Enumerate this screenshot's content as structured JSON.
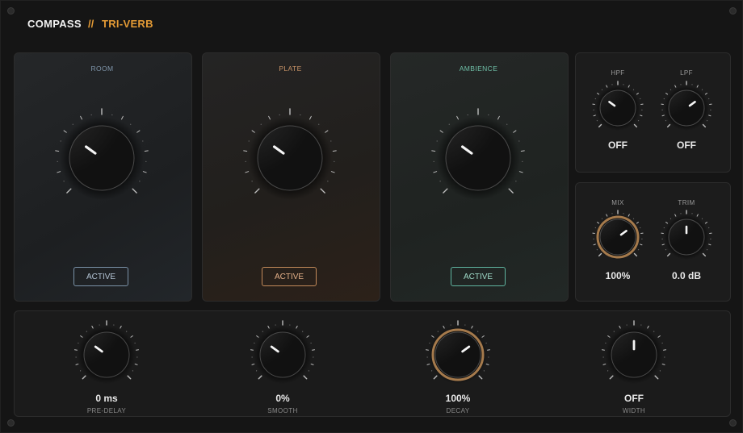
{
  "header": {
    "brand": "COMPASS",
    "separator": "//",
    "product": "TRI-VERB"
  },
  "modes": [
    {
      "label": "ROOM",
      "button": "ACTIVE",
      "label_color": "#7f95aa"
    },
    {
      "label": "PLATE",
      "button": "ACTIVE",
      "label_color": "#c99467"
    },
    {
      "label": "AMBIENCE",
      "button": "ACTIVE",
      "label_color": "#6fbfa7"
    }
  ],
  "filter": {
    "hpf": {
      "label": "HPF",
      "value": "OFF"
    },
    "lpf": {
      "label": "LPF",
      "value": "OFF"
    }
  },
  "output": {
    "mix": {
      "label": "MIX",
      "value": "100%"
    },
    "trim": {
      "label": "TRIM",
      "value": "0.0 dB"
    }
  },
  "controls": [
    {
      "value": "0 ms",
      "label": "PRE-DELAY"
    },
    {
      "value": "0%",
      "label": "SMOOTH"
    },
    {
      "value": "100%",
      "label": "DECAY"
    },
    {
      "value": "OFF",
      "label": "WIDTH"
    }
  ],
  "colors": {
    "accent": "#e39a35",
    "ring": "#a57a4c"
  }
}
